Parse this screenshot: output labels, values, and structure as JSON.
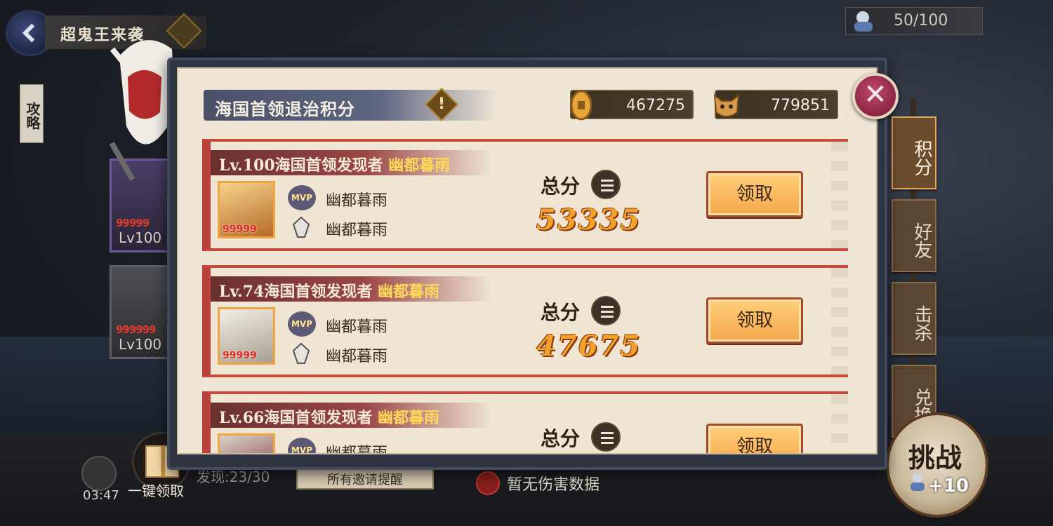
{
  "event": {
    "title": "超鬼王来袭",
    "guide_label": "攻略"
  },
  "stamina": {
    "value": "50/100"
  },
  "heroes": [
    {
      "stars": "99999",
      "level": "Lv100"
    },
    {
      "stars": "999999",
      "level": "Lv100"
    }
  ],
  "modal": {
    "title": "海国首领退治积分",
    "info_icon": "!",
    "currencies": [
      {
        "icon": "coin-icon",
        "value": "467275"
      },
      {
        "icon": "oni-mask-icon",
        "value": "779851"
      }
    ],
    "close_label": "✕",
    "rows": [
      {
        "level_text": "Lv.100海国首领发现者",
        "owner": "幽都暮雨",
        "portrait_stars": "99999",
        "mvp_label": "MVP",
        "mvp_name": "幽都暮雨",
        "discoverer_name": "幽都暮雨",
        "total_label": "总分",
        "score": "53335",
        "claim_label": "领取"
      },
      {
        "level_text": "Lv.74海国首领发现者",
        "owner": "幽都暮雨",
        "portrait_stars": "99999",
        "mvp_label": "MVP",
        "mvp_name": "幽都暮雨",
        "discoverer_name": "幽都暮雨",
        "total_label": "总分",
        "score": "47675",
        "claim_label": "领取"
      },
      {
        "level_text": "Lv.66海国首领发现者",
        "owner": "幽都暮雨",
        "portrait_stars": "",
        "mvp_label": "MVP",
        "mvp_name": "幽都暮雨",
        "discoverer_name": "",
        "total_label": "总分",
        "score": "",
        "claim_label": "领取"
      }
    ]
  },
  "tabs": [
    {
      "label": "积分",
      "active": true
    },
    {
      "label": "好友",
      "active": false
    },
    {
      "label": "击杀",
      "active": false
    },
    {
      "label": "兑换",
      "active": false
    }
  ],
  "bottom": {
    "timer": "03:47",
    "gift_label": "一键领取",
    "discover_text": "发现:23/30",
    "invite_label": "所有邀请提醒",
    "damage_text": "暂无伤害数据",
    "fight_label": "挑战",
    "fight_cost": "+10"
  }
}
